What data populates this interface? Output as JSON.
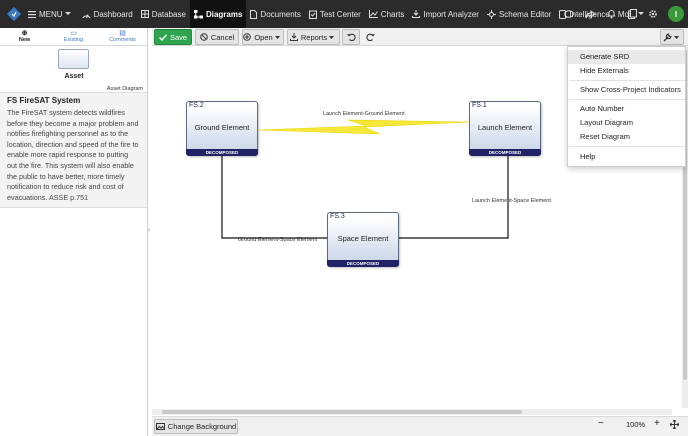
{
  "nav": {
    "menu": "MENU",
    "items": [
      {
        "label": "Dashboard",
        "icon": "dashboard-icon"
      },
      {
        "label": "Database",
        "icon": "database-icon"
      },
      {
        "label": "Diagrams",
        "icon": "diagrams-icon",
        "active": true
      },
      {
        "label": "Documents",
        "icon": "documents-icon"
      },
      {
        "label": "Test Center",
        "icon": "test-center-icon"
      },
      {
        "label": "Charts",
        "icon": "charts-icon"
      },
      {
        "label": "Import Analyzer",
        "icon": "import-analyzer-icon"
      },
      {
        "label": "Schema Editor",
        "icon": "schema-editor-icon"
      },
      {
        "label": "Intelligence",
        "icon": "intelligence-icon"
      },
      {
        "label": "More",
        "icon": "chevron-down-icon"
      }
    ],
    "avatar_initial": "I",
    "brand_color": "#3a78c3"
  },
  "left_panel": {
    "tabs": [
      {
        "label": "New",
        "icon": "plus-circle-icon"
      },
      {
        "label": "Existing",
        "icon": "folder-icon"
      },
      {
        "label": "Comments",
        "icon": "comment-icon"
      }
    ],
    "asset_label": "Asset",
    "asset_type": "Asset Diagram",
    "title": "FS FireSAT System",
    "description": "The FireSAT system detects wildfires before they become a major problem and notifies firefighting personnel as to the location, direction and speed of the fire to enable more rapid response to putting out the fire. This system will also enable the public to have better, more timely notification to reduce risk and cost of evacuations. ASSE p.751"
  },
  "toolbar": {
    "save": "Save",
    "cancel": "Cancel",
    "open": "Open",
    "reports": "Reports"
  },
  "diagram": {
    "nodes": [
      {
        "id": "FS.2",
        "name": "Ground Element",
        "badge": "DECOMPOSED"
      },
      {
        "id": "FS.1",
        "name": "Launch Element",
        "badge": "DECOMPOSED"
      },
      {
        "id": "FS.3",
        "name": "Space Element",
        "badge": "DECOMPOSED"
      }
    ],
    "edges": [
      {
        "label": "Launch Element-Ground Element"
      },
      {
        "label": "Launch Element-Space Element"
      },
      {
        "label": "Ground Element-Space Element"
      }
    ]
  },
  "dropdown": {
    "items": [
      "Generate SRD",
      "Hide Externals",
      "Show Cross-Project Indicators",
      "Auto Number",
      "Layout Diagram",
      "Reset Diagram",
      "Help"
    ]
  },
  "footer": {
    "change_background": "Change Background",
    "zoom": "100%"
  }
}
